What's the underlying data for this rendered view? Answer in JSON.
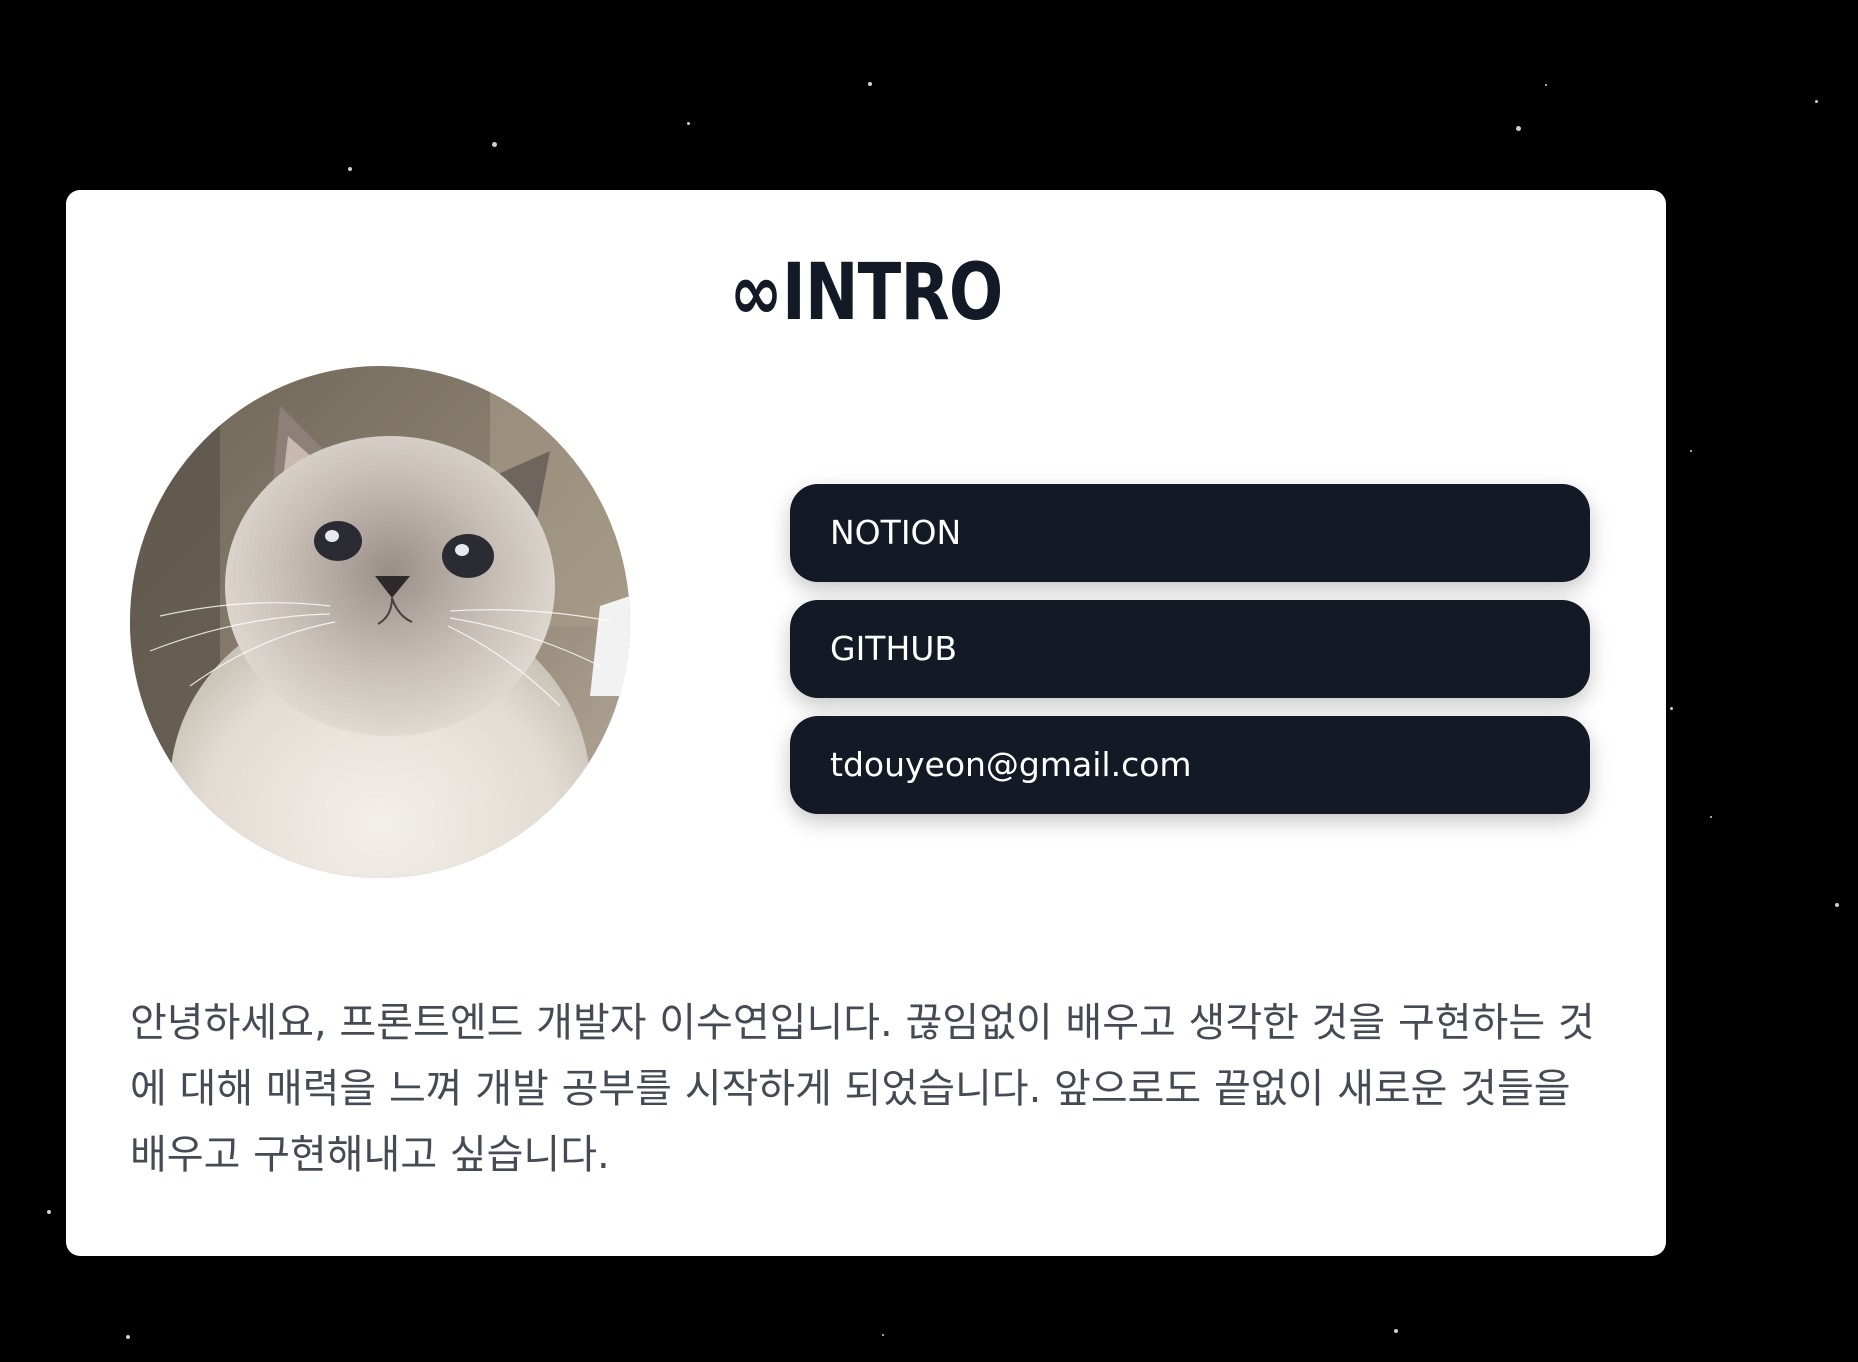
{
  "intro": {
    "title": "∞INTRO",
    "avatar_icon": "cat-photo",
    "links": {
      "notion": "NOTION",
      "github": "GITHUB",
      "email": "tdouyeon@gmail.com"
    },
    "bio": "안녕하세요, 프론트엔드 개발자 이수연입니다. 끊임없이 배우고 생각한 것을 구현하는 것에 대해 매력을 느껴 개발 공부를 시작하게 되었습니다. 앞으로도 끝없이 새로운 것들을 배우고 구현해내고 싶습니다."
  },
  "colors": {
    "background": "#000000",
    "card": "#ffffff",
    "button": "#131925",
    "title": "#131a26",
    "bio_text": "#454b55"
  }
}
